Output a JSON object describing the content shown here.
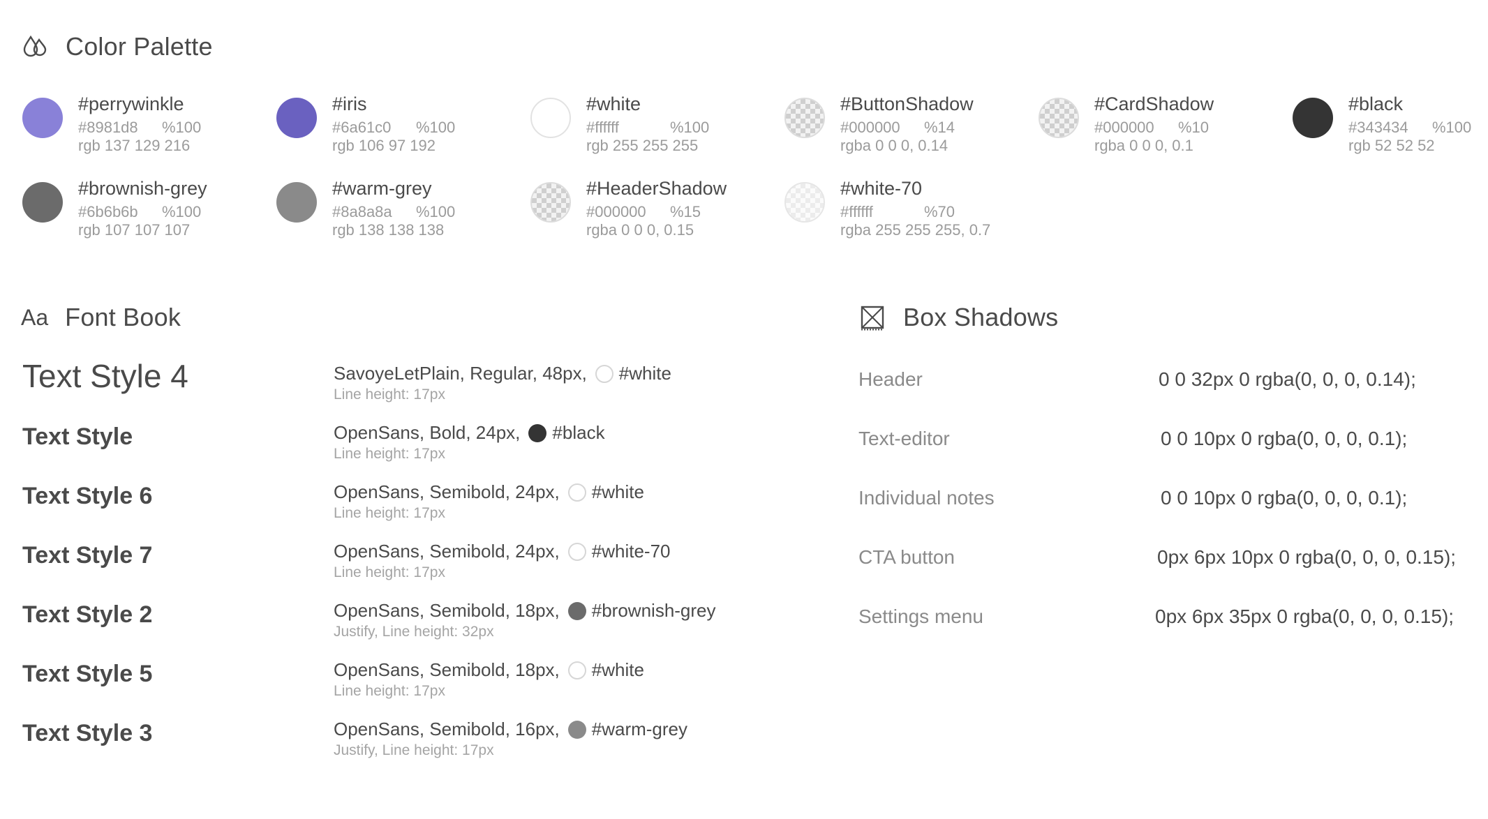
{
  "sections": {
    "palette_title": "Color Palette",
    "fontbook_title": "Font Book",
    "fontbook_icon_text": "Aa",
    "shadows_title": "Box Shadows"
  },
  "palette": [
    {
      "name": "#perrywinkle",
      "hex": "#8981d8",
      "opacity": "%100",
      "rgb": "rgb 137 129 216",
      "color": "#8981d8"
    },
    {
      "name": "#iris",
      "hex": "#6a61c0",
      "opacity": "%100",
      "rgb": "rgb 106 97 192",
      "color": "#6a61c0"
    },
    {
      "name": "#white",
      "hex": "#ffffff",
      "opacity": "%100",
      "rgb": "rgb 255 255 255",
      "color": "#ffffff"
    },
    {
      "name": "#ButtonShadow",
      "hex": "#000000",
      "opacity": "%14",
      "rgb": "rgba 0 0 0, 0.14",
      "color": "checker"
    },
    {
      "name": "#CardShadow",
      "hex": "#000000",
      "opacity": "%10",
      "rgb": "rgba 0 0 0, 0.1",
      "color": "checker"
    },
    {
      "name": "#black",
      "hex": "#343434",
      "opacity": "%100",
      "rgb": "rgb 52 52 52",
      "color": "#343434"
    },
    {
      "name": "#brownish-grey",
      "hex": "#6b6b6b",
      "opacity": "%100",
      "rgb": "rgb 107 107 107",
      "color": "#6b6b6b"
    },
    {
      "name": "#warm-grey",
      "hex": "#8a8a8a",
      "opacity": "%100",
      "rgb": "rgb 138 138 138",
      "color": "#8a8a8a"
    },
    {
      "name": "#HeaderShadow",
      "hex": "#000000",
      "opacity": "%15",
      "rgb": "rgba 0 0 0, 0.15",
      "color": "checker"
    },
    {
      "name": "#white-70",
      "hex": "#ffffff",
      "opacity": "%70",
      "rgb": "rgba 255 255 255, 0.7",
      "color": "checker-light"
    }
  ],
  "fontbook": [
    {
      "style": "Text Style 4",
      "desc": "SavoyeLetPlain, Regular, 48px,",
      "color_name": "#white",
      "dot": "#ffffff",
      "meta": "Line height: 17px"
    },
    {
      "style": "Text Style",
      "desc": "OpenSans, Bold, 24px,",
      "color_name": "#black",
      "dot": "#343434",
      "meta": "Line height: 17px"
    },
    {
      "style": "Text Style 6",
      "desc": "OpenSans, Semibold, 24px,",
      "color_name": "#white",
      "dot": "#ffffff",
      "meta": "Line height: 17px"
    },
    {
      "style": "Text Style 7",
      "desc": "OpenSans, Semibold, 24px,",
      "color_name": "#white-70",
      "dot": "#ffffff",
      "meta": "Line height: 17px"
    },
    {
      "style": "Text Style 2",
      "desc": "OpenSans, Semibold, 18px,",
      "color_name": "#brownish-grey",
      "dot": "#6b6b6b",
      "meta": "Justify, Line height: 32px"
    },
    {
      "style": "Text Style 5",
      "desc": "OpenSans, Semibold, 18px,",
      "color_name": "#white",
      "dot": "#ffffff",
      "meta": "Line height: 17px"
    },
    {
      "style": "Text Style 3",
      "desc": "OpenSans, Semibold, 16px,",
      "color_name": "#warm-grey",
      "dot": "#8a8a8a",
      "meta": "Justify, Line height: 17px"
    }
  ],
  "shadows": [
    {
      "label": "Header",
      "value": "0 0 32px 0 rgba(0, 0, 0, 0.14);"
    },
    {
      "label": "Text-editor",
      "value": "0 0 10px 0 rgba(0, 0, 0, 0.1);"
    },
    {
      "label": "Individual notes",
      "value": "0 0 10px 0 rgba(0, 0, 0, 0.1);"
    },
    {
      "label": "CTA button",
      "value": "0px 6px 10px 0 rgba(0, 0, 0, 0.15);"
    },
    {
      "label": "Settings menu",
      "value": "0px 6px 35px 0 rgba(0, 0, 0, 0.15);"
    }
  ]
}
